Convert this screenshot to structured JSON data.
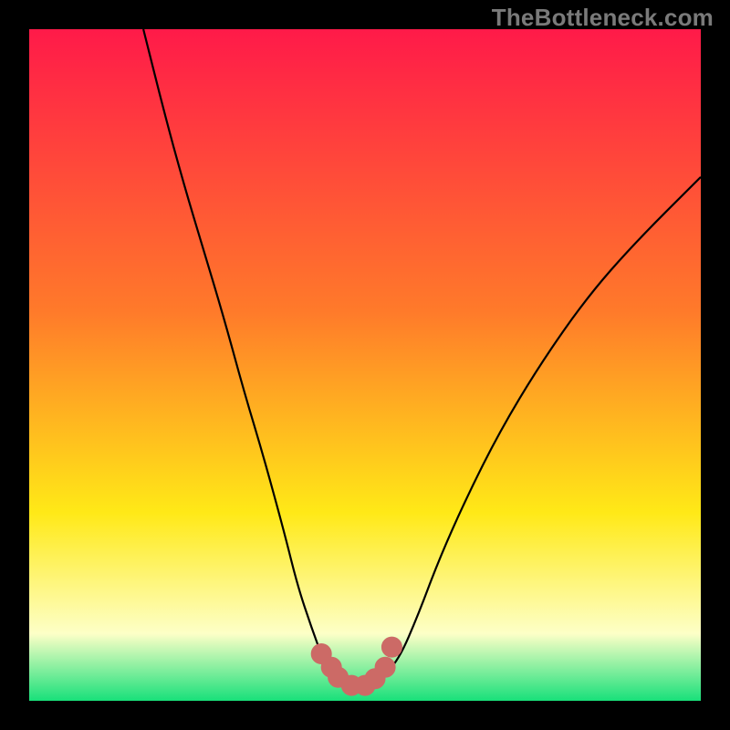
{
  "watermark": "TheBottleneck.com",
  "colors": {
    "gradient_top": "#ff1a49",
    "gradient_mid1": "#ff7a2a",
    "gradient_mid2": "#ffe917",
    "gradient_pale": "#fdffc7",
    "gradient_bottom": "#18e07a",
    "curve_stroke": "#000000",
    "marker_fill": "#cc6a66",
    "marker_stroke": "#cc6a66"
  },
  "chart_data": {
    "type": "line",
    "title": "",
    "xlabel": "",
    "ylabel": "",
    "xlim": [
      0,
      100
    ],
    "ylim": [
      0,
      100
    ],
    "grid": false,
    "legend": false,
    "series": [
      {
        "name": "bottleneck-curve",
        "x": [
          17,
          20,
          23,
          26,
          29,
          32,
          35,
          38,
          40,
          42,
          44,
          46,
          48,
          50,
          52,
          55,
          58,
          61,
          65,
          70,
          76,
          83,
          90,
          100
        ],
        "y": [
          100,
          88,
          77,
          67,
          57,
          46,
          36,
          25,
          17,
          11,
          5.5,
          3,
          2,
          2,
          3,
          6,
          13,
          21,
          30,
          40,
          50,
          60,
          68,
          78
        ]
      }
    ],
    "markers": {
      "name": "highlight-dots",
      "x": [
        43.5,
        45,
        46,
        48,
        50,
        51.5,
        53,
        54
      ],
      "y": [
        7,
        5,
        3.5,
        2.3,
        2.3,
        3.3,
        5,
        8
      ]
    }
  }
}
